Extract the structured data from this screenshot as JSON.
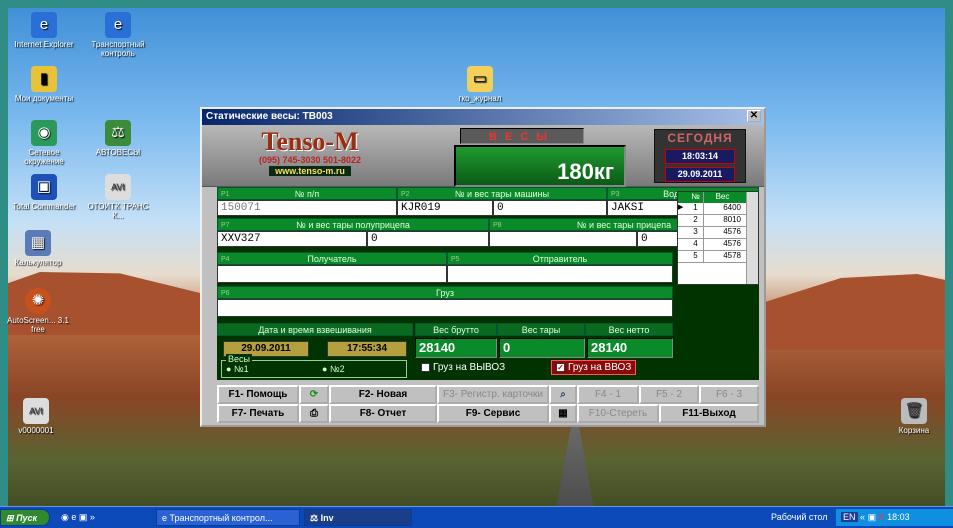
{
  "desktop": {
    "icons": [
      {
        "label": "Internet Explorer",
        "icon": "ie-icon"
      },
      {
        "label": "Транспортный контроль",
        "icon": "ie-shortcut-icon"
      },
      {
        "label": "Мои документы",
        "icon": "folder-icon"
      },
      {
        "label": "гко_журнал",
        "icon": "folder-icon"
      },
      {
        "label": "Сетевое окружение",
        "icon": "network-icon"
      },
      {
        "label": "АВТОВЕСЫ",
        "icon": "app-icon"
      },
      {
        "label": "Total Commander",
        "icon": "floppy-icon"
      },
      {
        "label": "ОТОИТК ТРАНС К...",
        "icon": "avi-icon"
      },
      {
        "label": "Калькулятор",
        "icon": "calculator-icon"
      },
      {
        "label": "AutoScreen... 3.1 free",
        "icon": "film-reel-icon"
      },
      {
        "label": "v0000001",
        "icon": "avi-icon"
      },
      {
        "label": "Корзина",
        "icon": "recycle-bin-icon"
      }
    ]
  },
  "window": {
    "title": "Статические весы: ТВ003",
    "close": "✕",
    "logo": {
      "name": "Tenso-M",
      "phone": "(095) 745-3030 501-8022",
      "site": "www.tenso-m.ru"
    },
    "vesy_label": "ВЕСЫ",
    "weight": "180кг",
    "today": {
      "label": "СЕГОДНЯ",
      "time": "18:03:14",
      "date": "29.09.2011"
    }
  },
  "form": {
    "labels": {
      "p1": "№ п/п",
      "p2": "№ и вес тары машины",
      "p3": "Водитель",
      "p7": "№ и вес тары полуприцепа",
      "p8": "№ и вес тары прицепа",
      "p4": "Получатель",
      "p5": "Отправитель",
      "p6": "Груз",
      "dt": "Дата и время взвешивания",
      "gross": "Вес брутто",
      "tare": "Вес тары",
      "net": "Вес нетто",
      "scales": "Весы"
    },
    "tags": {
      "p1": "P1",
      "p2": "P2",
      "p3": "P3",
      "p7": "P7",
      "p8": "P8",
      "p4": "P4",
      "p5": "P5",
      "p6": "P6"
    },
    "values": {
      "num": "150071",
      "car": "KJR019",
      "car_tare": "0",
      "driver": "JAKSI",
      "semi": "XXV327",
      "semi_tare": "0",
      "trailer": "",
      "trailer_tare": "0",
      "receiver": "",
      "sender": "",
      "cargo": "",
      "date": "29.09.2011",
      "time": "17:55:34",
      "gross": "28140",
      "tare": "0",
      "net": "28140"
    },
    "scales": {
      "s1": "№1",
      "s2": "№2"
    },
    "checks": {
      "out": "Груз на  ВЫВОЗ",
      "in": "Груз на  ВВОЗ"
    }
  },
  "grid": {
    "headers": [
      "№",
      "Вес"
    ],
    "rows": [
      {
        "n": "1",
        "w": "6400"
      },
      {
        "n": "2",
        "w": "8010"
      },
      {
        "n": "3",
        "w": "4576"
      },
      {
        "n": "4",
        "w": "4576"
      },
      {
        "n": "5",
        "w": "4578"
      }
    ]
  },
  "buttons": {
    "help": "F1- Помощь",
    "new": "F2- Новая",
    "reg": "F3- Регистр. карточки",
    "f41": "F4 - 1",
    "f52": "F5 - 2",
    "f63": "F6 - 3",
    "print": "F7- Печать",
    "report": "F8- Отчет",
    "service": "F9- Сервис",
    "erase": "F10-Стереть",
    "exit": "F11-Выход"
  },
  "taskbar": {
    "start": "Пуск",
    "task1": "Транспортный контрол...",
    "task2": "Inv",
    "desk": "Рабочий стол",
    "lang": "EN",
    "clock": "18:03"
  }
}
